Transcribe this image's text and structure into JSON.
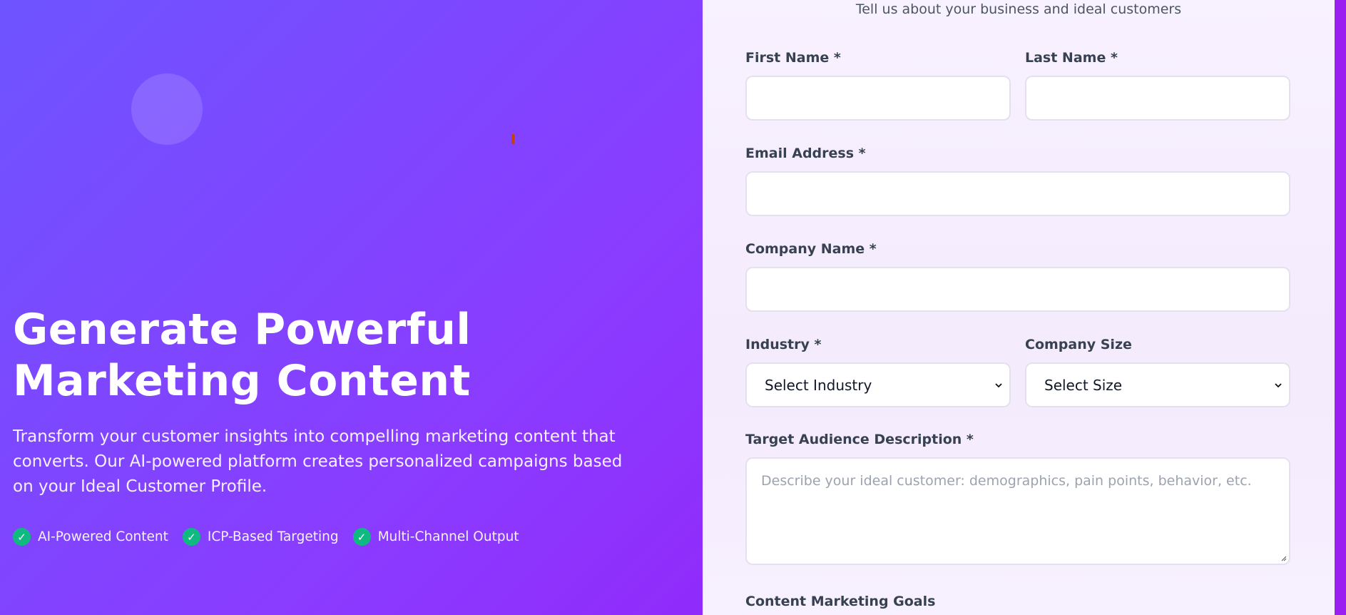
{
  "hero": {
    "title": "Generate Powerful Marketing Content",
    "description": "Transform your customer insights into compelling marketing content that converts. Our AI-powered platform creates personalized campaigns based on your Ideal Customer Profile.",
    "features": [
      {
        "label": "AI-Powered Content",
        "icon": "check-icon"
      },
      {
        "label": "ICP-Based Targeting",
        "icon": "check-icon"
      },
      {
        "label": "Multi-Channel Output",
        "icon": "check-icon"
      }
    ]
  },
  "form": {
    "subtitle": "Tell us about your business and ideal customers",
    "first_name": {
      "label": "First Name *",
      "value": ""
    },
    "last_name": {
      "label": "Last Name *",
      "value": ""
    },
    "email": {
      "label": "Email Address *",
      "value": ""
    },
    "company": {
      "label": "Company Name *",
      "value": ""
    },
    "industry": {
      "label": "Industry *",
      "selected": "Select Industry"
    },
    "company_size": {
      "label": "Company Size",
      "selected": "Select Size"
    },
    "target_audience": {
      "label": "Target Audience Description *",
      "placeholder": "Describe your ideal customer: demographics, pain points, behavior, etc."
    },
    "goals_label": "Content Marketing Goals"
  },
  "colors": {
    "gradient_start": "#6e54ff",
    "gradient_end": "#9a12f5",
    "check_green": "#10b981",
    "panel_bg": "#f8f1ff"
  }
}
